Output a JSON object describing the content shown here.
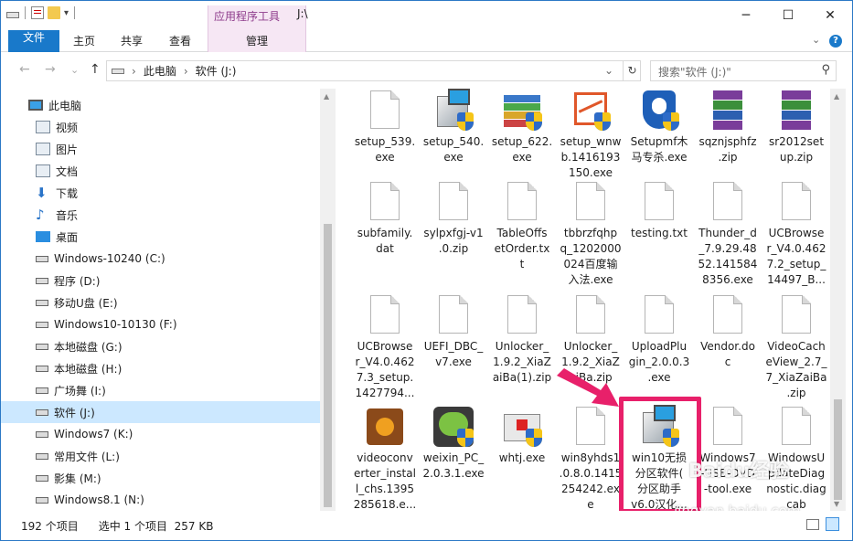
{
  "window": {
    "title": "J:\\",
    "context_tab_group": "应用程序工具",
    "controls": {
      "minimize": "─",
      "maximize": "☐",
      "close": "✕"
    }
  },
  "ribbon": {
    "tabs": [
      "文件",
      "主页",
      "共享",
      "查看",
      "管理"
    ],
    "expand": "⌄",
    "help": "?"
  },
  "address": {
    "back": "←",
    "forward": "→",
    "recent": "⌄",
    "up": "↑",
    "breadcrumb": [
      "此电脑",
      "软件 (J:)"
    ],
    "separator": "›",
    "dropdown": "⌄",
    "refresh": "↻",
    "search_placeholder": "搜索\"软件 (J:)\"",
    "search_icon": "⚲"
  },
  "nav": {
    "items": [
      {
        "label": "此电脑",
        "icon": "pc-icon"
      },
      {
        "label": "视频",
        "icon": "video-icon"
      },
      {
        "label": "图片",
        "icon": "pictures-icon"
      },
      {
        "label": "文档",
        "icon": "documents-icon"
      },
      {
        "label": "下载",
        "icon": "download-icon"
      },
      {
        "label": "音乐",
        "icon": "music-icon"
      },
      {
        "label": "桌面",
        "icon": "desktop-icon"
      },
      {
        "label": "Windows-10240 (C:)",
        "icon": "drive-icon"
      },
      {
        "label": "程序 (D:)",
        "icon": "drive-icon"
      },
      {
        "label": "移动U盘 (E:)",
        "icon": "drive-icon"
      },
      {
        "label": "Windows10-10130 (F:)",
        "icon": "drive-icon"
      },
      {
        "label": "本地磁盘 (G:)",
        "icon": "drive-icon"
      },
      {
        "label": "本地磁盘 (H:)",
        "icon": "drive-icon"
      },
      {
        "label": "广场舞 (I:)",
        "icon": "drive-icon"
      },
      {
        "label": "软件 (J:)",
        "icon": "drive-icon",
        "selected": true
      },
      {
        "label": "Windows7 (K:)",
        "icon": "drive-icon"
      },
      {
        "label": "常用文件 (L:)",
        "icon": "drive-icon"
      },
      {
        "label": "影集 (M:)",
        "icon": "drive-icon"
      },
      {
        "label": "Windows8.1 (N:)",
        "icon": "drive-icon"
      }
    ]
  },
  "files": [
    {
      "label": "setup_539.\nexe",
      "icon": "document-icon"
    },
    {
      "label": "setup_540.\nexe",
      "icon": "installer-icon"
    },
    {
      "label": "setup_622.\nexe",
      "icon": "books-installer-icon"
    },
    {
      "label": "setup_wnw\nb.1416193\n150.exe",
      "icon": "chart-installer-icon"
    },
    {
      "label": "Setupmf木\n马专杀.exe",
      "icon": "shield-app-icon"
    },
    {
      "label": "sqznjsphfz\n.zip",
      "icon": "winrar-icon"
    },
    {
      "label": "sr2012set\nup.zip",
      "icon": "winrar-icon"
    },
    {
      "label": "subfamily.\ndat",
      "icon": "document-icon"
    },
    {
      "label": "sylpxfgj-v1\n.0.zip",
      "icon": "document-icon"
    },
    {
      "label": "TableOffs\netOrder.tx\nt",
      "icon": "document-icon"
    },
    {
      "label": "tbbrzfqhp\nq_1202000\n024百度输\n入法.exe",
      "icon": "document-icon"
    },
    {
      "label": "testing.txt",
      "icon": "document-icon"
    },
    {
      "label": "Thunder_d\n_7.9.29.48\n52.141584\n8356.exe",
      "icon": "document-icon"
    },
    {
      "label": "UCBrowse\nr_V4.0.462\n7.2_setup_\n14497_B...",
      "icon": "document-icon"
    },
    {
      "label": "UCBrowse\nr_V4.0.462\n7.3_setup.\n1427794...",
      "icon": "document-icon"
    },
    {
      "label": "UEFI_DBC_\nv7.exe",
      "icon": "document-icon"
    },
    {
      "label": "Unlocker_\n1.9.2_XiaZ\naiBa(1).zip",
      "icon": "document-icon"
    },
    {
      "label": "Unlocker_\n1.9.2_XiaZ\naiBa.zip",
      "icon": "document-icon"
    },
    {
      "label": "UploadPlu\ngin_2.0.0.3\n.exe",
      "icon": "document-icon"
    },
    {
      "label": "Vendor.do\nc",
      "icon": "document-icon"
    },
    {
      "label": "VideoCach\neView_2.7_\n7_XiaZaiBa\n.zip",
      "icon": "document-icon"
    },
    {
      "label": "videoconv\nerter_instal\nl_chs.1395\n285618.e...",
      "icon": "converter-icon"
    },
    {
      "label": "weixin_PC_\n2.0.3.1.exe",
      "icon": "wechat-icon"
    },
    {
      "label": "whtj.exe",
      "icon": "toolbox-icon"
    },
    {
      "label": "win8yhds1\n.0.8.0.1415\n254242.ex\ne",
      "icon": "document-icon"
    },
    {
      "label": "win10无损\n分区软件(\n分区助手\nv6.0汉化...",
      "icon": "installer-icon",
      "selected": true
    },
    {
      "label": "Windows7\n-USB-DVD\n-tool.exe",
      "icon": "document-icon"
    },
    {
      "label": "WindowsU\npdateDiag\nnostic.diag\ncab",
      "icon": "document-icon"
    }
  ],
  "status": {
    "count": "192 个项目",
    "selection": "选中 1 个项目  257 KB"
  },
  "watermark": {
    "text1": "Baidu经验",
    "text2": "jingyan.baidu.com"
  },
  "colors": {
    "accent": "#1979ca",
    "highlight": "#e8206a",
    "context": "#f6e7f4"
  }
}
